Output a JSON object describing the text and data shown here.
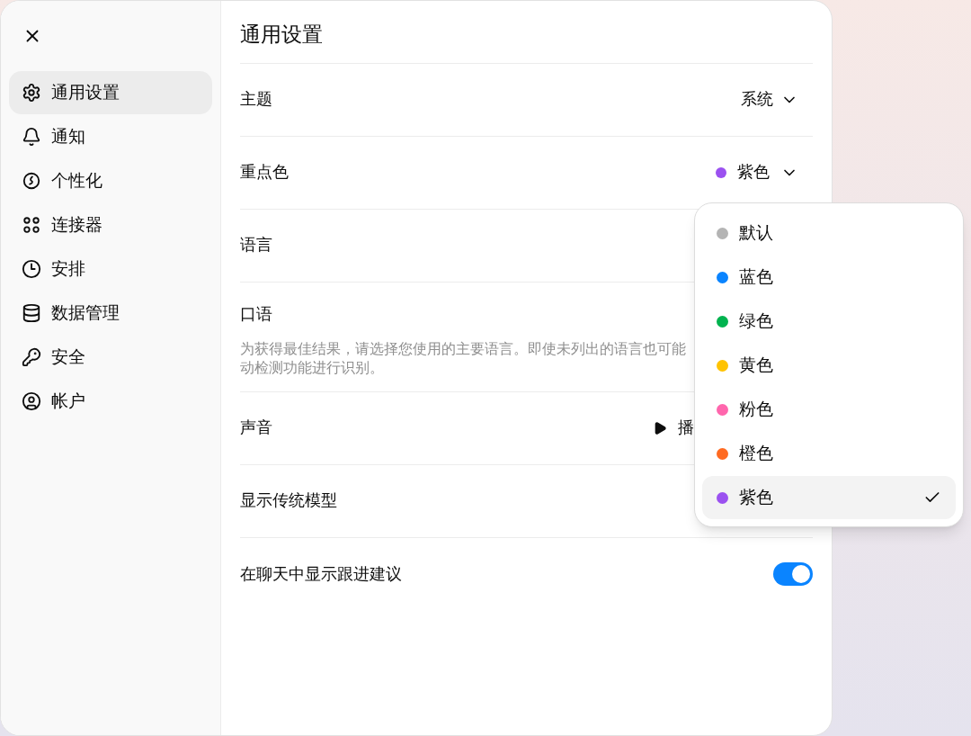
{
  "sidebar": {
    "items": [
      {
        "label": "通用设置",
        "selected": true
      },
      {
        "label": "通知",
        "selected": false
      },
      {
        "label": "个性化",
        "selected": false
      },
      {
        "label": "连接器",
        "selected": false
      },
      {
        "label": "安排",
        "selected": false
      },
      {
        "label": "数据管理",
        "selected": false
      },
      {
        "label": "安全",
        "selected": false
      },
      {
        "label": "帐户",
        "selected": false
      }
    ]
  },
  "settings": {
    "title": "通用设置",
    "rows": [
      {
        "kind": "select",
        "label": "主题",
        "value": "系统"
      },
      {
        "kind": "color_select",
        "label": "重点色",
        "value": "紫色",
        "color": "#9b51f0"
      },
      {
        "kind": "plain",
        "label": "语言"
      },
      {
        "kind": "description",
        "label": "口语",
        "description_lines": [
          "为获得最佳结果，请选择您使用的主要语言。即使未列出的语言也可能",
          "动检测功能进行识别。"
        ]
      },
      {
        "kind": "sound",
        "label": "声音",
        "button": "播"
      },
      {
        "kind": "plain",
        "label": "显示传统模型"
      },
      {
        "kind": "toggle",
        "label": "在聊天中显示跟进建议",
        "on": true
      }
    ]
  },
  "color_menu": {
    "items": [
      {
        "label": "默认",
        "color": "#b4b4b4",
        "selected": false
      },
      {
        "label": "蓝色",
        "color": "#0a84ff",
        "selected": false
      },
      {
        "label": "绿色",
        "color": "#00b34f",
        "selected": false
      },
      {
        "label": "黄色",
        "color": "#ffc300",
        "selected": false
      },
      {
        "label": "粉色",
        "color": "#ff66ad",
        "selected": false
      },
      {
        "label": "橙色",
        "color": "#ff6a21",
        "selected": false
      },
      {
        "label": "紫色",
        "color": "#9b51f0",
        "selected": true
      }
    ]
  }
}
